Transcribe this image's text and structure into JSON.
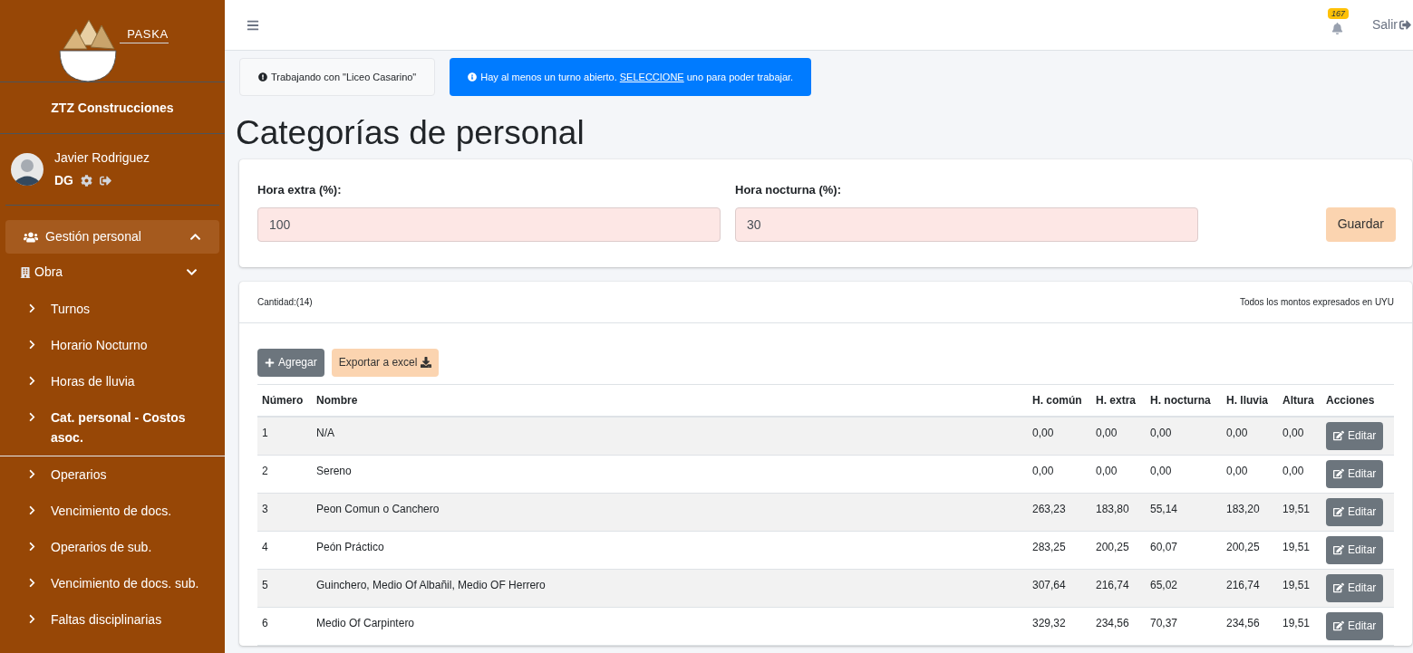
{
  "brand": {
    "logo_text": "PASKA",
    "company": "ZTZ Construcciones"
  },
  "user": {
    "name": "Javier Rodriguez",
    "role": "DG"
  },
  "sidebar": {
    "section": {
      "label": "Gestión personal",
      "expanded": true
    },
    "group": {
      "label": "Obra"
    },
    "items": [
      {
        "label": "Turnos",
        "selected": false
      },
      {
        "label": "Horario Nocturno",
        "selected": false
      },
      {
        "label": "Horas de lluvia",
        "selected": false
      },
      {
        "label": "Cat. personal - Costos asoc.",
        "selected": true
      },
      {
        "label": "Operarios",
        "selected": false
      },
      {
        "label": "Vencimiento de docs.",
        "selected": false
      },
      {
        "label": "Operarios de sub.",
        "selected": false
      },
      {
        "label": "Vencimiento de docs. sub.",
        "selected": false
      },
      {
        "label": "Faltas disciplinarias",
        "selected": false
      }
    ]
  },
  "topbar": {
    "notifications": "167",
    "logout": "Salir"
  },
  "notices": {
    "working": "Trabajando con \"Liceo Casarino\"",
    "alert_before": "Hay al menos un turno abierto.",
    "alert_link": "SELECCIONE",
    "alert_after": "uno para poder trabajar."
  },
  "page_title": "Categorías de personal",
  "settings": {
    "fields": [
      {
        "label": "Hora extra (%):",
        "value": "100"
      },
      {
        "label": "Hora nocturna (%):",
        "value": "30"
      }
    ],
    "save": "Guardar"
  },
  "table_card": {
    "count": "Cantidad:(14)",
    "currency_note": "Todos los montos expresados en UYU",
    "add": "Agregar",
    "export": "Exportar a excel",
    "columns": [
      "Número",
      "Nombre",
      "H. común",
      "H. extra",
      "H. nocturna",
      "H. lluvia",
      "Altura",
      "Acciones"
    ],
    "rows": [
      {
        "cells": [
          "1",
          "N/A",
          "0,00",
          "0,00",
          "0,00",
          "0,00",
          "0,00"
        ],
        "action": "Editar"
      },
      {
        "cells": [
          "2",
          "Sereno",
          "0,00",
          "0,00",
          "0,00",
          "0,00",
          "0,00"
        ],
        "action": "Editar"
      },
      {
        "cells": [
          "3",
          "Peon Comun o Canchero",
          "263,23",
          "183,80",
          "55,14",
          "183,20",
          "19,51"
        ],
        "action": "Editar"
      },
      {
        "cells": [
          "4",
          "Peón Práctico",
          "283,25",
          "200,25",
          "60,07",
          "200,25",
          "19,51"
        ],
        "action": "Editar"
      },
      {
        "cells": [
          "5",
          "Guinchero, Medio Of Albañil, Medio OF Herrero",
          "307,64",
          "216,74",
          "65,02",
          "216,74",
          "19,51"
        ],
        "action": "Editar"
      },
      {
        "cells": [
          "6",
          "Medio Of Carpintero",
          "329,32",
          "234,56",
          "70,37",
          "234,56",
          "19,51"
        ],
        "action": "Editar"
      }
    ]
  }
}
